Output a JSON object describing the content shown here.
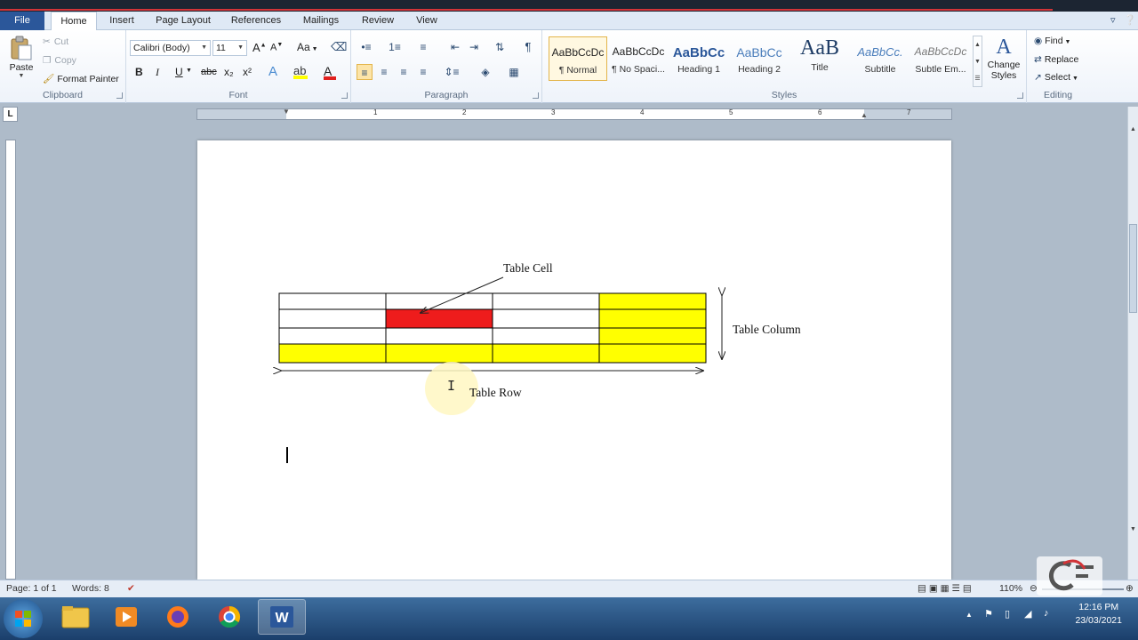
{
  "tabs": [
    {
      "label": "File"
    },
    {
      "label": "Home"
    },
    {
      "label": "Insert"
    },
    {
      "label": "Page Layout"
    },
    {
      "label": "References"
    },
    {
      "label": "Mailings"
    },
    {
      "label": "Review"
    },
    {
      "label": "View"
    }
  ],
  "clipboard": {
    "paste": "Paste",
    "cut": "Cut",
    "copy": "Copy",
    "format_painter": "Format Painter",
    "label": "Clipboard"
  },
  "font": {
    "name": "Calibri (Body)",
    "size": "11",
    "grow": "A",
    "shrink": "A",
    "change_case": "Aa",
    "bold": "B",
    "italic": "I",
    "underline": "U",
    "strike": "abc",
    "subscript": "x₂",
    "superscript": "x²",
    "label": "Font"
  },
  "paragraph": {
    "show_marks": "¶",
    "label": "Paragraph"
  },
  "styles": {
    "items": [
      {
        "preview": "AaBbCcDc",
        "name": "¶ Normal"
      },
      {
        "preview": "AaBbCcDc",
        "name": "¶ No Spaci..."
      },
      {
        "preview": "AaBbCc",
        "name": "Heading 1"
      },
      {
        "preview": "AaBbCc",
        "name": "Heading 2"
      },
      {
        "preview": "AaB",
        "name": "Title"
      },
      {
        "preview": "AaBbCc.",
        "name": "Subtitle"
      },
      {
        "preview": "AaBbCcDc",
        "name": "Subtle Em..."
      }
    ],
    "change_styles": "Change Styles",
    "label": "Styles"
  },
  "editing": {
    "find": "Find",
    "replace": "Replace",
    "select": "Select",
    "label": "Editing"
  },
  "ruler": {
    "numbers": [
      "1",
      "2",
      "3",
      "4",
      "5",
      "6",
      "7"
    ],
    "tab_selector": "L"
  },
  "document": {
    "table": {
      "rows": [
        [
          "white",
          "white",
          "white",
          "yellow"
        ],
        [
          "white",
          "red",
          "white",
          "yellow"
        ],
        [
          "white",
          "white",
          "white",
          "yellow"
        ],
        [
          "yellow",
          "yellow",
          "yellow",
          "yellow"
        ]
      ]
    },
    "colors": {
      "yellow": "#ffff00",
      "red": "#ee1c1c",
      "white": "#ffffff"
    },
    "label_cell": "Table Cell",
    "label_column": "Table Column",
    "label_row": "Table Row"
  },
  "status": {
    "page": "Page: 1 of 1",
    "words": "Words: 8",
    "zoom": "110%"
  },
  "taskbar": {
    "time": "12:16 PM",
    "date": "23/03/2021"
  }
}
